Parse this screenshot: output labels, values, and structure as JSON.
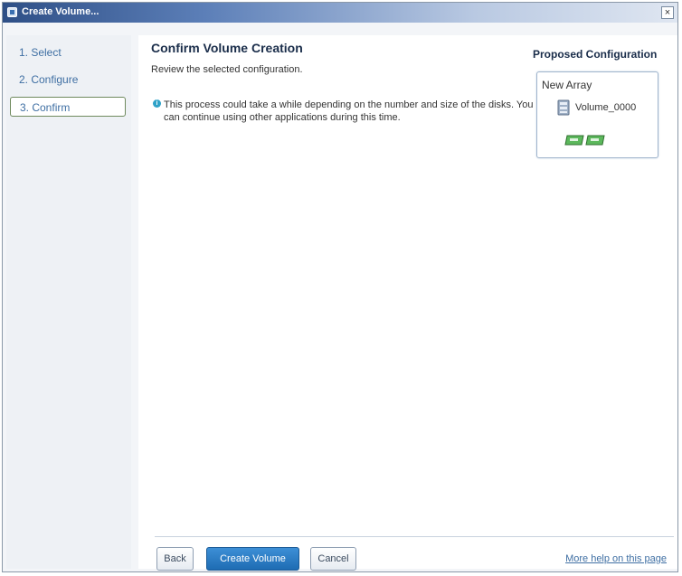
{
  "window": {
    "title": "Create Volume...",
    "close_glyph": "×"
  },
  "steps": [
    {
      "label": "1. Select",
      "current": false
    },
    {
      "label": "2. Configure",
      "current": false
    },
    {
      "label": "3. Confirm",
      "current": true
    }
  ],
  "main": {
    "heading": "Confirm Volume Creation",
    "subheading": "Review the selected configuration.",
    "info_icon": "info-icon",
    "info_text": "This process could take a while depending on the number and size of the disks. You can continue using other applications during this time."
  },
  "proposed": {
    "title": "Proposed Configuration",
    "array_label": "New Array",
    "volume_label": "Volume_0000",
    "disk_count": 2
  },
  "footer": {
    "back_label": "Back",
    "create_label": "Create Volume",
    "cancel_label": "Cancel",
    "help_link": "More help on this page"
  },
  "colors": {
    "accent": "#1e6cb3",
    "link": "#3f6fa3",
    "disk_green": "#5cb85c"
  }
}
